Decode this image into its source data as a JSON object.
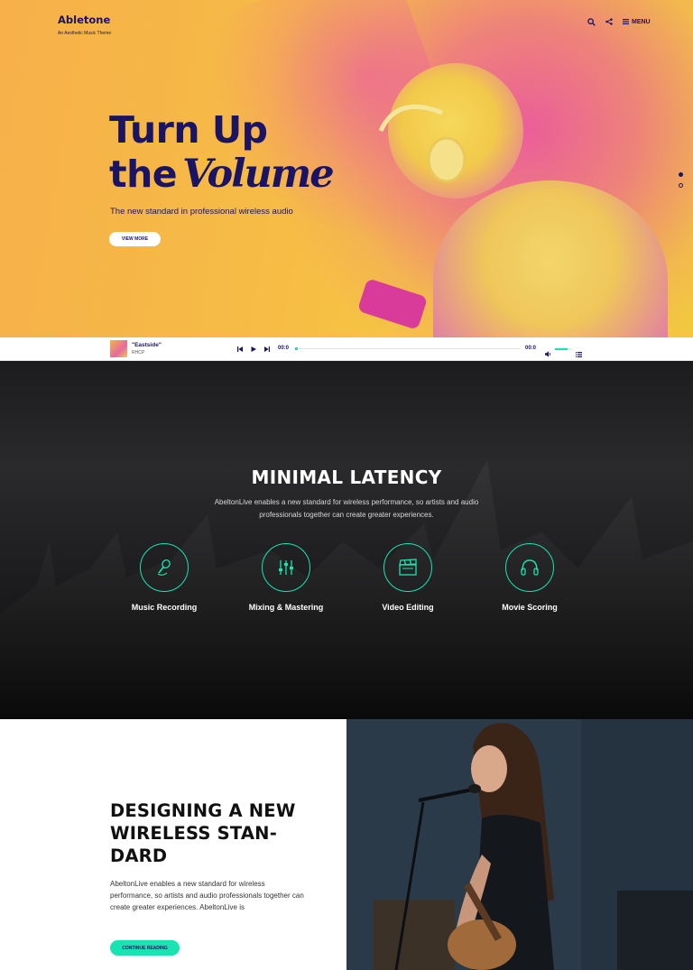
{
  "site": {
    "title": "Abletone",
    "tagline": "An Aesthetic Music Theme"
  },
  "nav": {
    "menu_label": "MENU",
    "icons": [
      "search-icon",
      "share-icon",
      "hamburger-icon"
    ]
  },
  "hero": {
    "line1": "Turn Up",
    "line2_word": "the",
    "line2_script": "Volume",
    "subtitle": "The new standard in professional wireless audio",
    "button": "VIEW MORE",
    "slides_total": 2,
    "slide_active": 1
  },
  "player": {
    "track_title": "\"Eastside\"",
    "artist": "RHCP",
    "time_current": "00:0",
    "time_total": "00:0",
    "progress": 0.01,
    "volume": 0.8
  },
  "features": {
    "title": "MINIMAL LATENCY",
    "description": "AbeltonLive enables a new standard for wireless performance, so artists and audio professionals together can create greater experiences.",
    "items": [
      {
        "label": "Music Recording",
        "icon": "microphone-icon"
      },
      {
        "label": "Mixing & Mastering",
        "icon": "sliders-icon"
      },
      {
        "label": "Video Editing",
        "icon": "clapperboard-icon"
      },
      {
        "label": "Movie Scoring",
        "icon": "headphones-icon"
      }
    ],
    "accent_color": "#19e3b1"
  },
  "about": {
    "title": "DESIGNING A NEW WIRELESS STAN-DARD",
    "title_lines": [
      "DESIGNING A NEW",
      "WIRELESS STAN-",
      "DARD"
    ],
    "description": "AbeltonLive enables a new standard for wireless performance, so artists and audio professionals together can create greater experiences. AbeltonLive is",
    "button": "CONTINUE READING"
  },
  "colors": {
    "navy": "#1b1464",
    "accent": "#19e3b1",
    "hero_yellow": "#f5c443",
    "hero_pink": "#e94ca8"
  }
}
